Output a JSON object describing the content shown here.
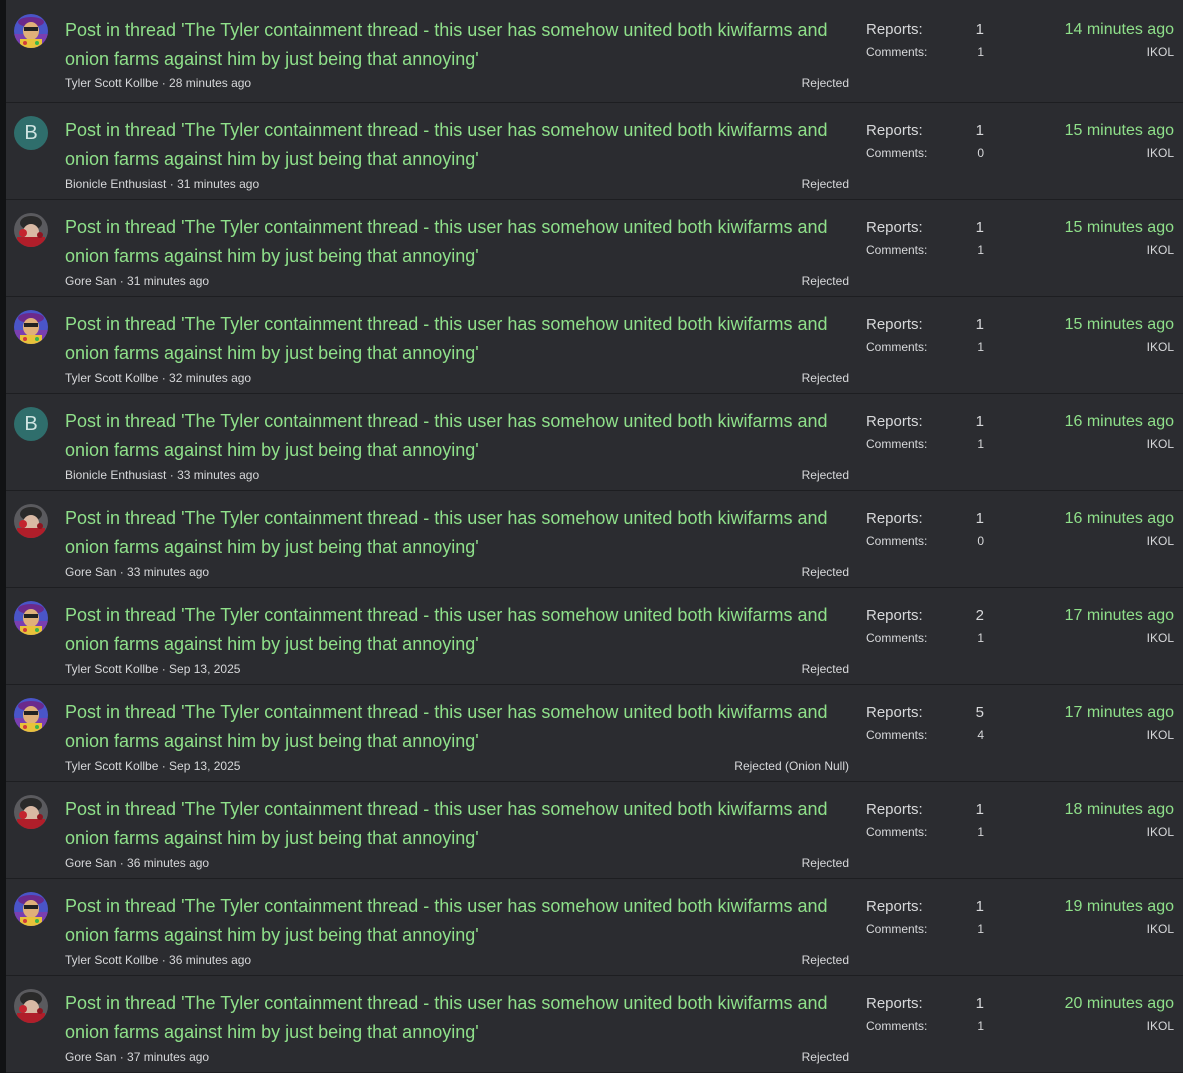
{
  "labels": {
    "reports": "Reports:",
    "comments": "Comments:"
  },
  "reports": [
    {
      "avatar": "tyler-avatar",
      "title": "Post in thread 'The Tyler containment thread - this user has somehow united both kiwifarms and onion farms against him by just being that annoying'",
      "user": "Tyler Scott Kollbe",
      "time": "28 minutes ago",
      "state": "Rejected",
      "reports": "1",
      "comments": "1",
      "when": "14 minutes ago",
      "moderator": "IKOL"
    },
    {
      "avatar": "letter-b",
      "letter": "B",
      "title": "Post in thread 'The Tyler containment thread - this user has somehow united both kiwifarms and onion farms against him by just being that annoying'",
      "user": "Bionicle Enthusiast",
      "time": "31 minutes ago",
      "state": "Rejected",
      "reports": "1",
      "comments": "0",
      "when": "15 minutes ago",
      "moderator": "IKOL"
    },
    {
      "avatar": "gore-avatar",
      "title": "Post in thread 'The Tyler containment thread - this user has somehow united both kiwifarms and onion farms against him by just being that annoying'",
      "user": "Gore San",
      "time": "31 minutes ago",
      "state": "Rejected",
      "reports": "1",
      "comments": "1",
      "when": "15 minutes ago",
      "moderator": "IKOL"
    },
    {
      "avatar": "tyler-avatar",
      "title": "Post in thread 'The Tyler containment thread - this user has somehow united both kiwifarms and onion farms against him by just being that annoying'",
      "user": "Tyler Scott Kollbe",
      "time": "32 minutes ago",
      "state": "Rejected",
      "reports": "1",
      "comments": "1",
      "when": "15 minutes ago",
      "moderator": "IKOL"
    },
    {
      "avatar": "letter-b",
      "letter": "B",
      "title": "Post in thread 'The Tyler containment thread - this user has somehow united both kiwifarms and onion farms against him by just being that annoying'",
      "user": "Bionicle Enthusiast",
      "time": "33 minutes ago",
      "state": "Rejected",
      "reports": "1",
      "comments": "1",
      "when": "16 minutes ago",
      "moderator": "IKOL"
    },
    {
      "avatar": "gore-avatar",
      "title": "Post in thread 'The Tyler containment thread - this user has somehow united both kiwifarms and onion farms against him by just being that annoying'",
      "user": "Gore San",
      "time": "33 minutes ago",
      "state": "Rejected",
      "reports": "1",
      "comments": "0",
      "when": "16 minutes ago",
      "moderator": "IKOL"
    },
    {
      "avatar": "tyler-avatar",
      "title": "Post in thread 'The Tyler containment thread - this user has somehow united both kiwifarms and onion farms against him by just being that annoying'",
      "user": "Tyler Scott Kollbe",
      "time": "Sep 13, 2025",
      "state": "Rejected",
      "reports": "2",
      "comments": "1",
      "when": "17 minutes ago",
      "moderator": "IKOL"
    },
    {
      "avatar": "tyler-avatar",
      "title": "Post in thread 'The Tyler containment thread - this user has somehow united both kiwifarms and onion farms against him by just being that annoying'",
      "user": "Tyler Scott Kollbe",
      "time": "Sep 13, 2025",
      "state": "Rejected (Onion Null)",
      "reports": "5",
      "comments": "4",
      "when": "17 minutes ago",
      "moderator": "IKOL"
    },
    {
      "avatar": "gore-avatar",
      "title": "Post in thread 'The Tyler containment thread - this user has somehow united both kiwifarms and onion farms against him by just being that annoying'",
      "user": "Gore San",
      "time": "36 minutes ago",
      "state": "Rejected",
      "reports": "1",
      "comments": "1",
      "when": "18 minutes ago",
      "moderator": "IKOL"
    },
    {
      "avatar": "tyler-avatar",
      "title": "Post in thread 'The Tyler containment thread - this user has somehow united both kiwifarms and onion farms against him by just being that annoying'",
      "user": "Tyler Scott Kollbe",
      "time": "36 minutes ago",
      "state": "Rejected",
      "reports": "1",
      "comments": "1",
      "when": "19 minutes ago",
      "moderator": "IKOL"
    },
    {
      "avatar": "gore-avatar",
      "title": "Post in thread 'The Tyler containment thread - this user has somehow united both kiwifarms and onion farms against him by just being that annoying'",
      "user": "Gore San",
      "time": "37 minutes ago",
      "state": "Rejected",
      "reports": "1",
      "comments": "1",
      "when": "20 minutes ago",
      "moderator": "IKOL"
    }
  ]
}
